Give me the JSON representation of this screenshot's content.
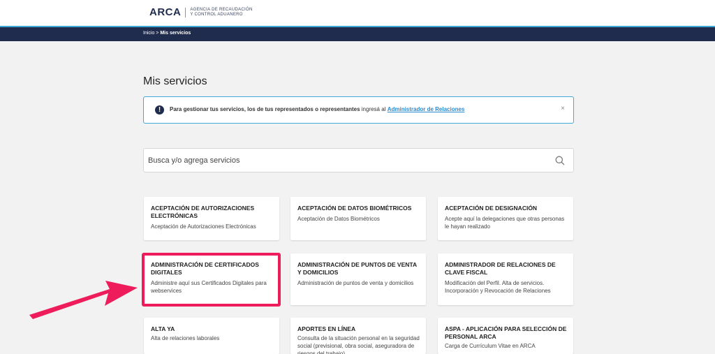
{
  "header": {
    "logo_text": "ARCA",
    "logo_sub_line1": "AGENCIA DE RECAUDACIÓN",
    "logo_sub_line2": "Y CONTROL ADUANERO"
  },
  "breadcrumb": {
    "home": "Inicio",
    "separator": ">",
    "current": "Mis servicios"
  },
  "page_title": "Mis servicios",
  "alert": {
    "bold_text": "Para gestionar tus servicios, los de tus representados o representantes",
    "normal_text": " ingresá al ",
    "link_text": "Administrador de Relaciones",
    "close": "×"
  },
  "search": {
    "placeholder": "Busca y/o agrega servicios"
  },
  "cards": [
    {
      "title": "ACEPTACIÓN DE AUTORIZACIONES ELECTRÓNICAS",
      "desc": "Aceptación de Autorizaciones Electrónicas"
    },
    {
      "title": "ACEPTACIÓN DE DATOS BIOMÉTRICOS",
      "desc": "Aceptación de Datos Biométricos"
    },
    {
      "title": "ACEPTACIÓN DE DESIGNACIÓN",
      "desc": "Acepte aquí la delegaciones que otras personas le hayan realizado"
    },
    {
      "title": "ADMINISTRACIÓN DE CERTIFICADOS DIGITALES",
      "desc": "Administre aquí sus Certificados Digitales para webservices"
    },
    {
      "title": "ADMINISTRACIÓN DE PUNTOS DE VENTA Y DOMICILIOS",
      "desc": "Administración de puntos de venta y domicilios"
    },
    {
      "title": "ADMINISTRADOR DE RELACIONES DE CLAVE FISCAL",
      "desc": "Modificación del Perfil. Alta de servicios. Incorporación y Revocación de Relaciones"
    },
    {
      "title": "ALTA YA",
      "desc": "Alta de relaciones laborales"
    },
    {
      "title": "APORTES EN LÍNEA",
      "desc": "Consulta de la situación personal en la seguridad social (previsional, obra social, aseguradora de riesgos del trabajo)"
    },
    {
      "title": "ASPA - APLICACIÓN PARA SELECCIÓN DE PERSONAL ARCA",
      "desc": "Carga de Currículum Vitae en ARCA"
    }
  ],
  "colors": {
    "navy": "#1f2c4d",
    "accent": "#3fa9d8",
    "highlight": "#ee1c5a"
  }
}
